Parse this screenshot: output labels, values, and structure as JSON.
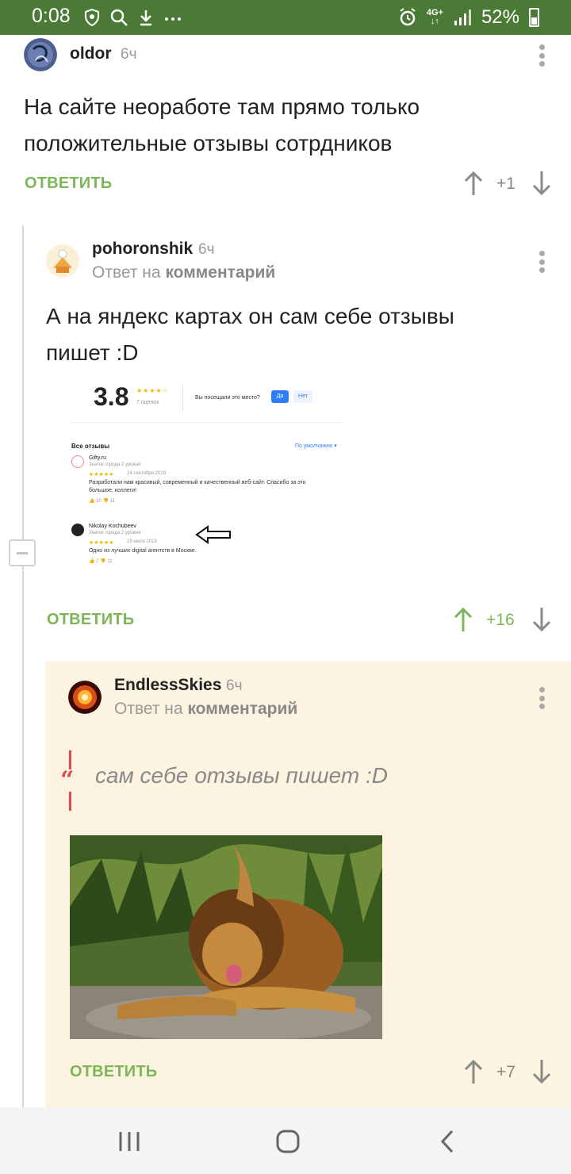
{
  "status_bar": {
    "time": "0:08",
    "battery": "52%",
    "network_top": "4G+",
    "network_bottom": "↓↑",
    "icons_left": [
      "shield-icon",
      "search-icon",
      "download-icon",
      "more-dots-icon"
    ],
    "icons_right": [
      "alarm-icon",
      "network-icon",
      "signal-icon",
      "battery-icon"
    ]
  },
  "comments": [
    {
      "username": "oldor",
      "time": "6ч",
      "text_line1": "На сайте неоработе там прямо только",
      "text_line2": "положительные отзывы сотрдников",
      "reply_label": "ОТВЕТИТЬ",
      "score": "+1"
    },
    {
      "username": "pohoronshik",
      "time": "6ч",
      "reply_prefix": "Ответ на",
      "reply_link": "комментарий",
      "text_line1": "А на яндекс картах он сам себе отзывы",
      "text_line2": "пишет :D",
      "reply_label": "ОТВЕТИТЬ",
      "score": "+16",
      "score_color": "#7db559",
      "embedded_screenshot": {
        "rating": "3.8",
        "stars": "★★★★☆",
        "count": "7 оценок",
        "question": "Вы посещали это место?",
        "yes": "Да",
        "no": "Нет",
        "all_reviews": "Все отзывы",
        "sort": "По умолчанию ▾",
        "reviews": [
          {
            "name": "Gifty.ru",
            "level": "Знаток города 2 уровня",
            "stars": "★★★★★",
            "date": "24 сентября 2019",
            "text": "Разработали нам красивый, современный и качественный веб-сайт. Спасибо за это большое, коллеги!",
            "likes": "👍 10   👎 11"
          },
          {
            "name": "Nikolay Kochubeev",
            "level": "Знаток города 2 уровня",
            "stars": "★★★★★",
            "date": "19 июля 2019",
            "text": "Одно из лучших digital агентств в Москве.",
            "likes": "👍 7   👎 11"
          }
        ]
      }
    },
    {
      "username": "EndlessSkies",
      "time": "6ч",
      "reply_prefix": "Ответ на",
      "reply_link": "комментарий",
      "quote": "сам себе отзывы пишет :D",
      "reply_label": "ОТВЕТИТЬ",
      "score": "+7"
    }
  ],
  "colors": {
    "status_bar": "#4b7a36",
    "accent_green": "#7db559",
    "highlight_bg": "#fcf4e1",
    "quote_red": "#e0484e"
  },
  "nav_bar": {
    "icons": [
      "recent-apps-icon",
      "home-icon",
      "back-icon"
    ]
  }
}
